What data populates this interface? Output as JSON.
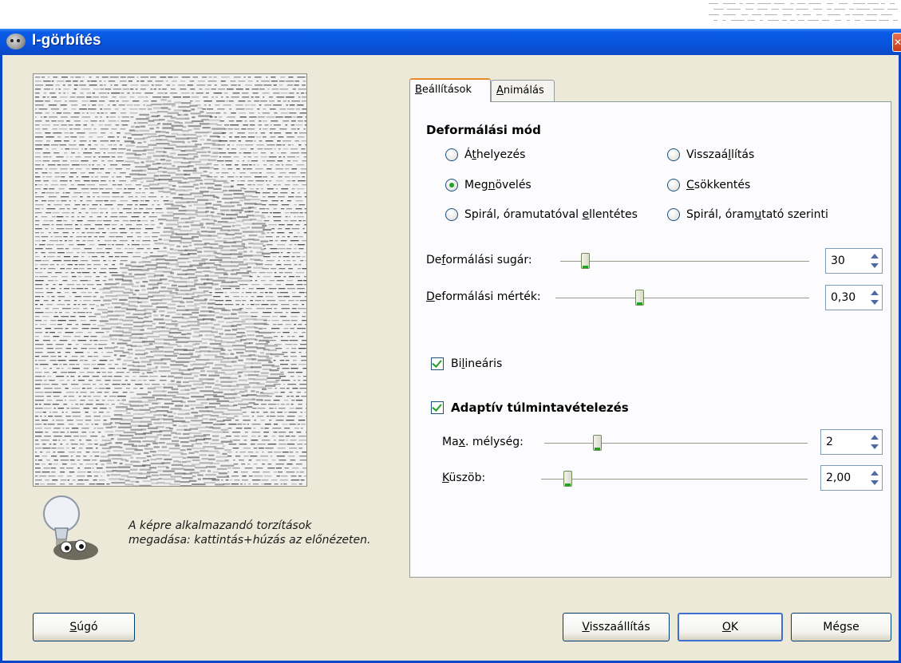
{
  "window": {
    "title": "I-görbítés"
  },
  "hint": {
    "text_line1": "A képre alkalmazandó torzítások",
    "text_line2": "megadása: kattintás+húzás az előnézeten."
  },
  "tabs": [
    {
      "label_pre": "",
      "label_u": "B",
      "label_post": "eállítások",
      "active": true
    },
    {
      "label_pre": "",
      "label_u": "A",
      "label_post": "nimálás",
      "active": false
    }
  ],
  "deform_mode": {
    "title": "Deformálási mód",
    "options": [
      {
        "pre": "Á",
        "u": "t",
        "post": "helyezés",
        "selected": false
      },
      {
        "pre": "Visszaá",
        "u": "l",
        "post": "lítás",
        "selected": false
      },
      {
        "pre": "Meg",
        "u": "n",
        "post": "övelés",
        "selected": true
      },
      {
        "pre": "",
        "u": "C",
        "post": "sökkentés",
        "selected": false
      },
      {
        "pre": "Spirál, óramutatóval ",
        "u": "e",
        "post": "llentétes",
        "selected": false
      },
      {
        "pre": "Spirál, óram",
        "u": "u",
        "post": "tató szerinti",
        "selected": false
      }
    ]
  },
  "sliders": {
    "radius": {
      "pre": "De",
      "u": "f",
      "post": "ormálási sugár:",
      "value": "30",
      "fraction": 0.1
    },
    "amount": {
      "pre": "",
      "u": "D",
      "post": "eformálási mérték:",
      "value": "0,30",
      "fraction": 0.33
    },
    "depth": {
      "pre": "Ma",
      "u": "x",
      "post": ". mélység:",
      "value": "2",
      "fraction": 0.2
    },
    "threshold": {
      "pre": "",
      "u": "K",
      "post": "üszöb:",
      "value": "2,00",
      "fraction": 0.1
    }
  },
  "bilinear": {
    "pre": "Bi",
    "u": "l",
    "post": "ineáris",
    "checked": true
  },
  "adaptive": {
    "label": "Adaptív túlmintavételezés",
    "checked": true
  },
  "buttons": {
    "help": {
      "pre": "",
      "u": "S",
      "post": "úgó"
    },
    "reset": {
      "pre": "",
      "u": "V",
      "post": "isszaállítás"
    },
    "ok": {
      "pre": "",
      "u": "O",
      "post": "K"
    },
    "cancel": {
      "label": "Mégse"
    }
  },
  "colors": {
    "titlebar": "#0855dd",
    "accent_tab": "#e68b2c",
    "check": "#21a121"
  }
}
